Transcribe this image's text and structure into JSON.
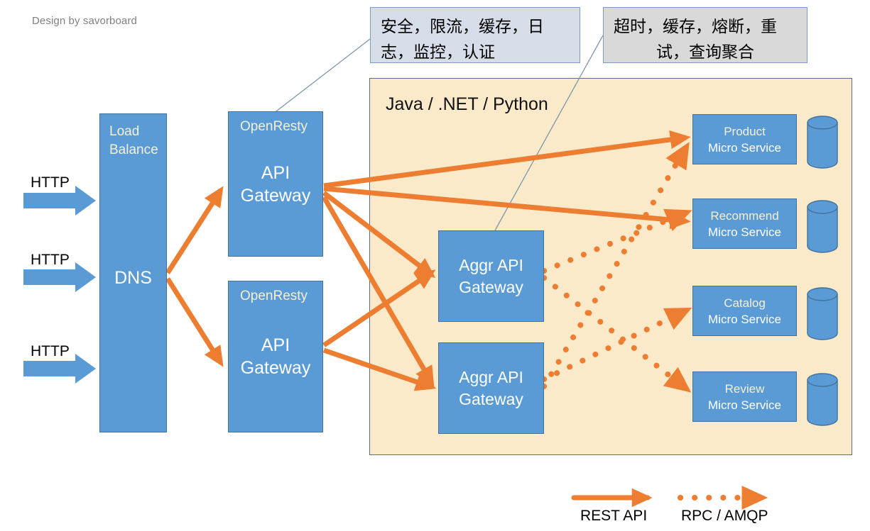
{
  "credit": "Design by savorboard",
  "callouts": [
    {
      "name": "gateway-concerns",
      "line1": "安全，限流，缓存，日",
      "line2": "志，监控，认证"
    },
    {
      "name": "aggregation-concerns",
      "line1": "超时，缓存，熔断，重",
      "line2": "试，查询聚合"
    }
  ],
  "platform": {
    "label": "Java / .NET / Python"
  },
  "load_balancer": {
    "title_line1": "Load",
    "title_line2": "Balance",
    "dns": "DNS"
  },
  "ingress": [
    {
      "label": "HTTP"
    },
    {
      "label": "HTTP"
    },
    {
      "label": "HTTP"
    }
  ],
  "gateways": [
    {
      "tech": "OpenResty",
      "line1": "API",
      "line2": "Gateway"
    },
    {
      "tech": "OpenResty",
      "line1": "API",
      "line2": "Gateway"
    }
  ],
  "aggregators": [
    {
      "line1": "Aggr API",
      "line2": "Gateway"
    },
    {
      "line1": "Aggr API",
      "line2": "Gateway"
    }
  ],
  "microservices": [
    {
      "name": "Product",
      "kind": "Micro Service"
    },
    {
      "name": "Recommend",
      "kind": "Micro Service"
    },
    {
      "name": "Catalog",
      "kind": "Micro Service"
    },
    {
      "name": "Review",
      "kind": "Micro Service"
    }
  ],
  "legend": [
    {
      "style": "solid",
      "label": "REST API"
    },
    {
      "style": "dotted",
      "label": "RPC / AMQP"
    }
  ],
  "colors": {
    "box_fill": "#5b9bd5",
    "box_stroke": "#41719c",
    "platform_fill": "#fbeaca",
    "platform_stroke": "#5b6b7a",
    "arrow": "#ed7d31",
    "callout_blue": "#d6dce8",
    "callout_grey": "#d9d9d9",
    "leader_line": "#7f96ab",
    "credit_text": "#808080"
  }
}
